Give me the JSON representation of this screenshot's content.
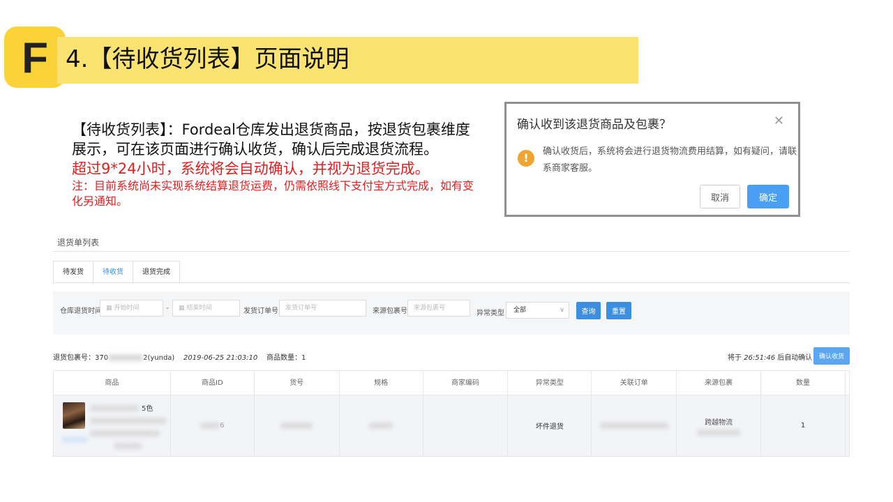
{
  "slide": {
    "logo_letter": "F",
    "title": "4.【待收货列表】页面说明",
    "desc_main": "【待收货列表】：Fordeal仓库发出退货商品，按退货包裹维度展示，可在该页面进行确认收货，确认后完成退货流程。",
    "desc_warning": "超过9*24小时，系统将会自动确认，并视为退货完成。",
    "desc_note": "注：目前系统尚未实现系统结算退货运费，仍需依照线下支付宝方式完成，如有变化另通知。"
  },
  "dialog": {
    "title": "确认收到该退货商品及包裹？",
    "message": "确认收货后，系统将会进行退货物流费用结算，如有疑问，请联系商家客服。",
    "cancel_label": "取消",
    "ok_label": "确定"
  },
  "panel": {
    "title": "退货单列表",
    "tabs": [
      "待发货",
      "待收货",
      "退货完成"
    ],
    "filter": {
      "date_label": "仓库退货时间",
      "start_placeholder": "开始时间",
      "dash": "-",
      "end_placeholder": "结束时间",
      "order_label": "发货订单号",
      "order_placeholder": "发货订单号",
      "pkg_label": "来源包裹号",
      "pkg_placeholder": "来源包裹号",
      "type_label": "异常类型",
      "type_value": "全部",
      "query_label": "查询",
      "reset_label": "重置"
    },
    "package": {
      "no_prefix": "退货包裹号：370",
      "no_suffix": "2(yunda)",
      "time": "2019-06-25 21:03:10",
      "qty_label": "商品数量：1",
      "auto_prefix": "将于",
      "countdown": "26:51:46",
      "auto_suffix": "后自动确认",
      "confirm_label": "确认收货"
    },
    "table": {
      "headers": [
        "商品",
        "商品ID",
        "货号",
        "规格",
        "商家编码",
        "异常类型",
        "关联订单",
        "来源包裹",
        "数量"
      ],
      "row": {
        "product_partial": "5色",
        "product_id_partial": "6",
        "exception_type": "坏件退货",
        "source_pkg": "跨越物流",
        "quantity": "1"
      }
    }
  }
}
